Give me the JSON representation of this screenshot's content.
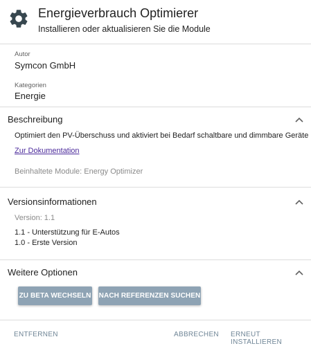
{
  "header": {
    "title": "Energieverbrauch Optimierer",
    "subtitle": "Installieren oder aktualisieren Sie die Module",
    "icon": "gear-icon"
  },
  "meta": {
    "author_label": "Autor",
    "author_value": "Symcon GmbH",
    "category_label": "Kategorien",
    "category_value": "Energie"
  },
  "description": {
    "heading": "Beschreibung",
    "text": "Optimiert den PV-Überschuss und aktiviert bei Bedarf schaltbare und dimmbare Geräte",
    "doc_link": "Zur Dokumentation",
    "modules": "Beinhaltete Module: Energy Optimizer"
  },
  "versions": {
    "heading": "Versionsinformationen",
    "version": "Version: 1.1",
    "entries": [
      "1.1 - Unterstützung für E-Autos",
      "1.0 - Erste Version"
    ]
  },
  "options": {
    "heading": "Weitere Optionen",
    "beta_button": "ZU BETA WECHSELN",
    "references_button": "NACH REFERENZEN SUCHEN"
  },
  "footer": {
    "remove": "ENTFERNEN",
    "cancel": "ABBRECHEN",
    "reinstall": "ERNEUT INSTALLIEREN"
  },
  "colors": {
    "button_bg": "#8ea3b4",
    "footer_text": "#6f8596",
    "link": "#4b2a9b"
  }
}
